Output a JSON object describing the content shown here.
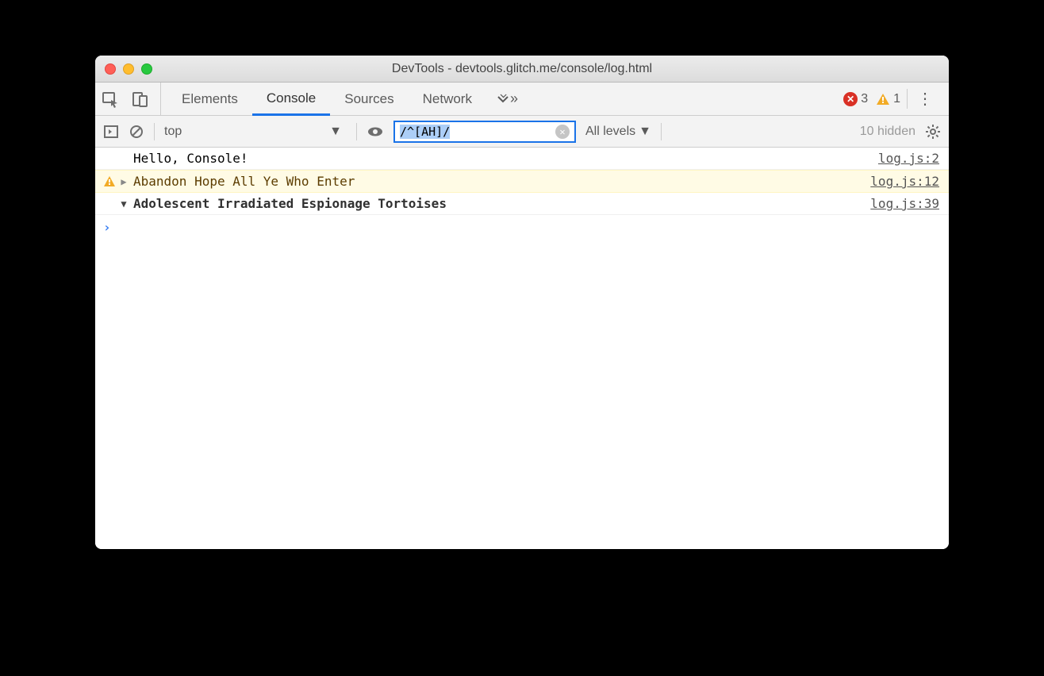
{
  "window": {
    "title": "DevTools - devtools.glitch.me/console/log.html"
  },
  "tabs": {
    "items": [
      "Elements",
      "Console",
      "Sources",
      "Network"
    ],
    "active": "Console"
  },
  "status": {
    "errors": 3,
    "warnings": 1
  },
  "toolbar": {
    "context": "top",
    "filter": "/^[AH]/",
    "levels": "All levels",
    "hidden": "10 hidden"
  },
  "log": {
    "rows": [
      {
        "type": "log",
        "text": "Hello, Console!",
        "src": "log.js:2"
      },
      {
        "type": "warn",
        "text": "Abandon Hope All Ye Who Enter",
        "src": "log.js:12",
        "disclosure": "closed"
      },
      {
        "type": "group",
        "text": "Adolescent Irradiated Espionage Tortoises",
        "src": "log.js:39",
        "disclosure": "open"
      }
    ]
  }
}
